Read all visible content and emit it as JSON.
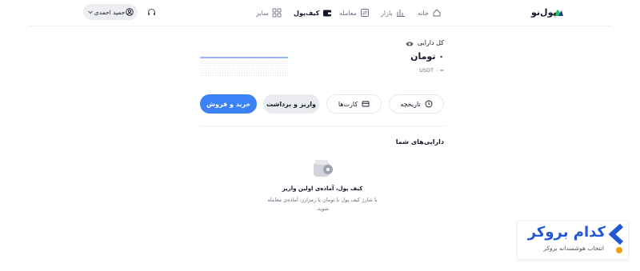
{
  "brand": {
    "logo_text": "پول‌نو"
  },
  "nav": {
    "home": "خانه",
    "market": "بازار",
    "trade": "معامله",
    "wallet": "کیف‌پول",
    "more": "سایر"
  },
  "user": {
    "name": "حمید احمدی"
  },
  "wallet": {
    "total_label": "کل دارایی",
    "balance": "۰ تومان",
    "usdt": "USDT ۰ ≈"
  },
  "actions": {
    "history": "تاریخچه",
    "cards": "کارت‌ها",
    "deposit_withdraw": "واریز و برداشت",
    "buy_sell": "خرید و فروش"
  },
  "assets": {
    "title": "دارایی‌های شما",
    "empty_title": "کیف پول، آماده‌ی اولین واریز",
    "empty_desc": "با شارژ کیف پول با تومان یا رمزارز، آماده‌ی معامله شوید."
  },
  "watermark": {
    "title": "کدام بروکر",
    "subtitle": "انتخاب هوشمندانه بروکر"
  },
  "colors": {
    "accent": "#3b82f6",
    "badge_blue": "#2457d6",
    "badge_orange": "#f59e0b"
  }
}
